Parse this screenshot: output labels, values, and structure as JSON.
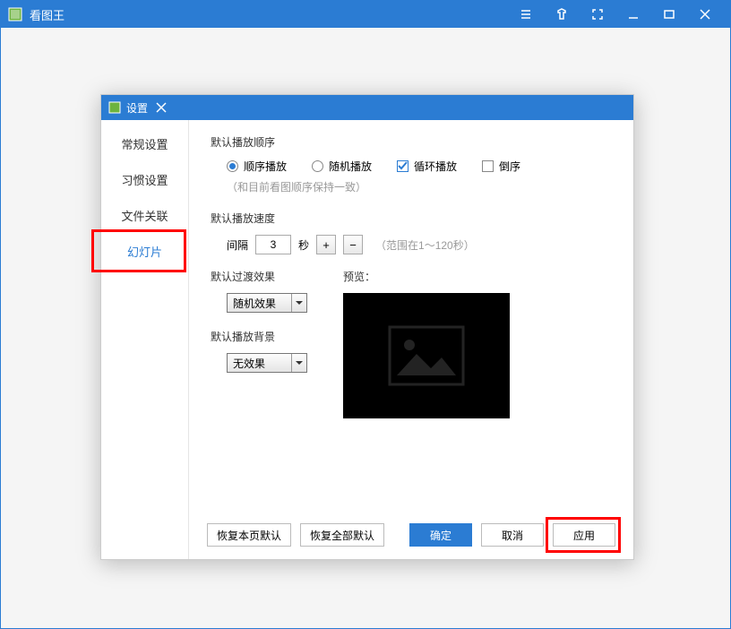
{
  "app": {
    "title": "看图王"
  },
  "dialog": {
    "title": "设置",
    "sidebar": [
      {
        "label": "常规设置"
      },
      {
        "label": "习惯设置"
      },
      {
        "label": "文件关联"
      },
      {
        "label": "幻灯片"
      }
    ],
    "play_order": {
      "label": "默认播放顺序",
      "options": {
        "seq": "顺序播放",
        "random": "随机播放",
        "loop": "循环播放",
        "reverse": "倒序"
      },
      "hint": "（和目前看图顺序保持一致）"
    },
    "play_speed": {
      "label": "默认播放速度",
      "interval_label": "间隔",
      "value": "3",
      "unit": "秒",
      "range_hint": "（范围在1～120秒）"
    },
    "transition": {
      "label": "默认过渡效果",
      "value": "随机效果"
    },
    "background": {
      "label": "默认播放背景",
      "value": "无效果"
    },
    "preview_label": "预览：",
    "buttons": {
      "reset_page": "恢复本页默认",
      "reset_all": "恢复全部默认",
      "ok": "确定",
      "cancel": "取消",
      "apply": "应用"
    }
  }
}
